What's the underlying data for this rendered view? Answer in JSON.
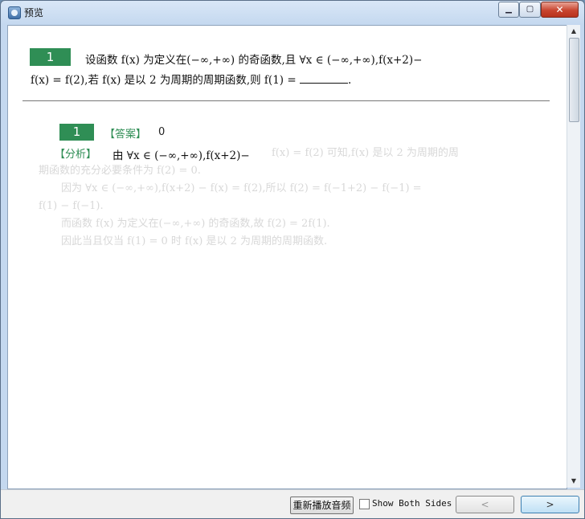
{
  "window": {
    "title": "预览",
    "min_glyph": "▁",
    "max_glyph": "▢",
    "close_glyph": "✕"
  },
  "content": {
    "question": {
      "number": "1",
      "line1": "设函数 f(x) 为定义在(−∞,+∞) 的奇函数,且 ∀x ∈ (−∞,+∞),f(x+2)−",
      "line2_start": "f(x) = f(2),若 f(x) 是以 2 为周期的周期函数,则 f(1) = ",
      "line2_end": "."
    },
    "answer": {
      "number": "1",
      "label": "【答案】",
      "value": "0"
    },
    "analysis": {
      "label": "【分析】",
      "text": "由 ∀x ∈ (−∞,+∞),f(x+2)−",
      "faded_lines": [
        "f(x) = f(2) 可知,f(x) 是以 2 为周期的周",
        "期函数的充分必要条件为 f(2) = 0.",
        "因为 ∀x ∈ (−∞,+∞),f(x+2) − f(x) = f(2),所以 f(2) = f(−1+2) − f(−1) =",
        "f(1) − f(−1).",
        "而函数 f(x) 为定义在(−∞,+∞) 的奇函数,故 f(2) = 2f(1).",
        "因此当且仅当 f(1) = 0 时 f(x) 是以 2 为周期的周期函数."
      ]
    }
  },
  "scrollbar": {
    "up_glyph": "▲",
    "down_glyph": "▼"
  },
  "footer": {
    "replay_label": "重新播放音频",
    "show_both_sides_label": "Show Both Sides",
    "prev_glyph": "<",
    "next_glyph": ">"
  }
}
